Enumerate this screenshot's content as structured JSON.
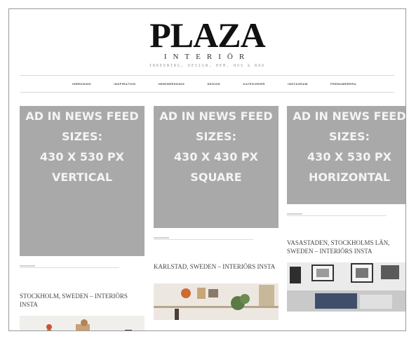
{
  "header": {
    "logo_title": "PLAZA",
    "logo_subtitle": "INTERIÖR",
    "tagline": "INREDNING, DESIGN, HEM, HUS & BAD"
  },
  "nav": {
    "items": [
      "INREDNING",
      "INSPIRATION",
      "HEMINREDNING",
      "DESIGN",
      "KATEGORIER",
      "INSTAGRAM",
      "PRENUMERERA"
    ]
  },
  "columns": [
    {
      "ad_lines": [
        "AD IN NEWS FEED",
        "SIZES:",
        "430 X 530 PX",
        "VERTICAL"
      ],
      "post_title": "STOCKHOLM, SWEDEN – INTERIÖRS INSTA"
    },
    {
      "ad_lines": [
        "AD IN NEWS FEED",
        "SIZES:",
        "430 X 430 PX",
        "SQUARE"
      ],
      "post_title": "KARLSTAD, SWEDEN – INTERIÖRS INSTA"
    },
    {
      "ad_lines": [
        "AD IN NEWS FEED",
        "SIZES:",
        "430 X 530 PX",
        "HORIZONTAL"
      ],
      "post_title": "VASASTADEN, STOCKHOLMS LÄN, SWEDEN – INTERIÖRS INSTA"
    }
  ],
  "colors": {
    "ad_background": "#a9a9a9",
    "ad_text": "#f4f4f4",
    "logo": "#111111"
  }
}
